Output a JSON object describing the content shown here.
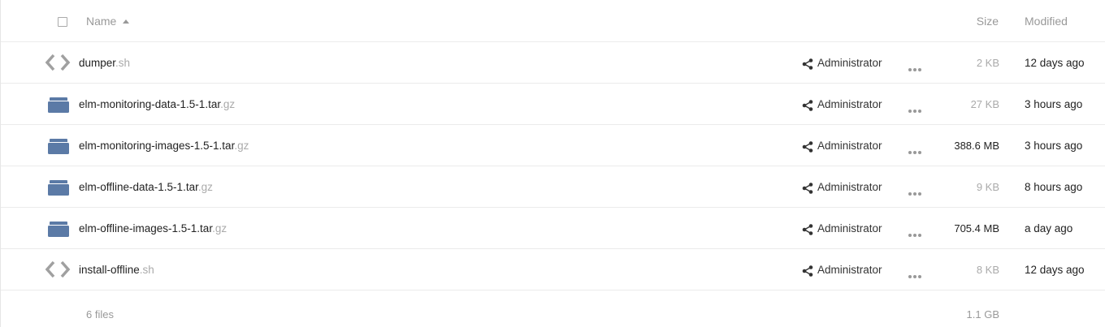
{
  "header": {
    "col_name": "Name",
    "col_size": "Size",
    "col_modified": "Modified"
  },
  "files": [
    {
      "name": "dumper",
      "ext": ".sh",
      "type": "script",
      "owner": "Administrator",
      "size": "2 KB",
      "size_color": "#aaaaaa",
      "modified": "12 days ago"
    },
    {
      "name": "elm-monitoring-data-1.5-1.tar",
      "ext": ".gz",
      "type": "archive",
      "owner": "Administrator",
      "size": "27 KB",
      "size_color": "#aaaaaa",
      "modified": "3 hours ago"
    },
    {
      "name": "elm-monitoring-images-1.5-1.tar",
      "ext": ".gz",
      "type": "archive",
      "owner": "Administrator",
      "size": "388.6 MB",
      "size_color": "#222222",
      "modified": "3 hours ago"
    },
    {
      "name": "elm-offline-data-1.5-1.tar",
      "ext": ".gz",
      "type": "archive",
      "owner": "Administrator",
      "size": "9 KB",
      "size_color": "#aaaaaa",
      "modified": "8 hours ago"
    },
    {
      "name": "elm-offline-images-1.5-1.tar",
      "ext": ".gz",
      "type": "archive",
      "owner": "Administrator",
      "size": "705.4 MB",
      "size_color": "#222222",
      "modified": "a day ago"
    },
    {
      "name": "install-offline",
      "ext": ".sh",
      "type": "script",
      "owner": "Administrator",
      "size": "8 KB",
      "size_color": "#aaaaaa",
      "modified": "12 days ago"
    }
  ],
  "footer": {
    "count": "6 files",
    "total_size": "1.1 GB"
  },
  "icons": {
    "script": "code-icon",
    "archive": "package-icon",
    "share": "share-icon",
    "more": "more-icon"
  },
  "colors": {
    "package_icon": "#5b7aa6",
    "code_icon": "#a0a0a0"
  }
}
